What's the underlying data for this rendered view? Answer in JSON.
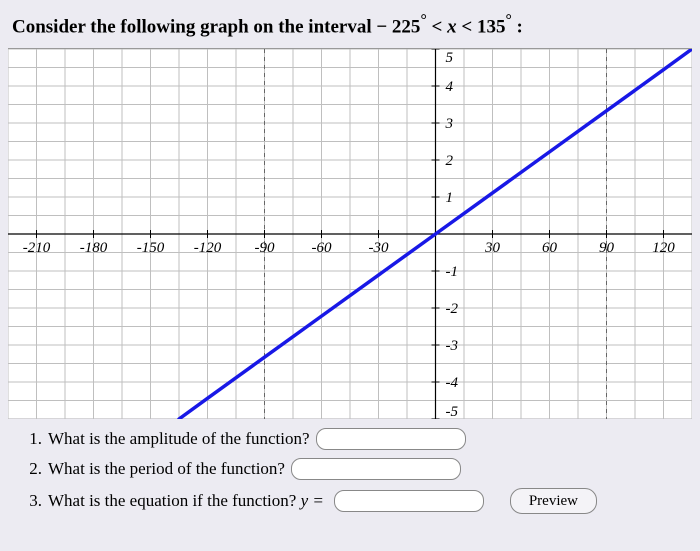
{
  "title_parts": {
    "prefix": "Consider the following graph on the interval ",
    "a": "− 225",
    "deg": "°",
    "lt1": " < ",
    "var": "x",
    "lt2": " < ",
    "b": "135",
    "colon": " :"
  },
  "questions": {
    "q1_num": "1.",
    "q1_text": "What is the amplitude of the function?",
    "q2_num": "2.",
    "q2_text": "What is the period of the function?",
    "q3_num": "3.",
    "q3_text": "What is the equation if the function? ",
    "q3_eq": "y =",
    "preview_label": "Preview"
  },
  "inputs": {
    "amp": "",
    "period": "",
    "eq": "",
    "amp_ph": "",
    "period_ph": "",
    "eq_ph": ""
  },
  "chart_data": {
    "type": "line",
    "x": [
      -135,
      -120,
      -90,
      -60,
      -30,
      0,
      30,
      60,
      90,
      120,
      135
    ],
    "values": [
      -5,
      -4.44,
      -3.33,
      -2.22,
      -1.11,
      0,
      1.11,
      2.22,
      3.33,
      4.44,
      5
    ],
    "title": "",
    "xlabel": "",
    "ylabel": "",
    "xlim": [
      -225,
      135
    ],
    "ylim": [
      -5,
      5
    ],
    "x_ticks": [
      -210,
      -180,
      -150,
      -120,
      -90,
      -60,
      -30,
      30,
      60,
      90,
      120
    ],
    "y_ticks": [
      -5,
      -4,
      -3,
      -2,
      -1,
      1,
      2,
      3,
      4,
      5
    ],
    "vertical_guides": [
      -90,
      90
    ],
    "minor_grid_x_step": 15,
    "minor_grid_y_step": 0.5
  }
}
